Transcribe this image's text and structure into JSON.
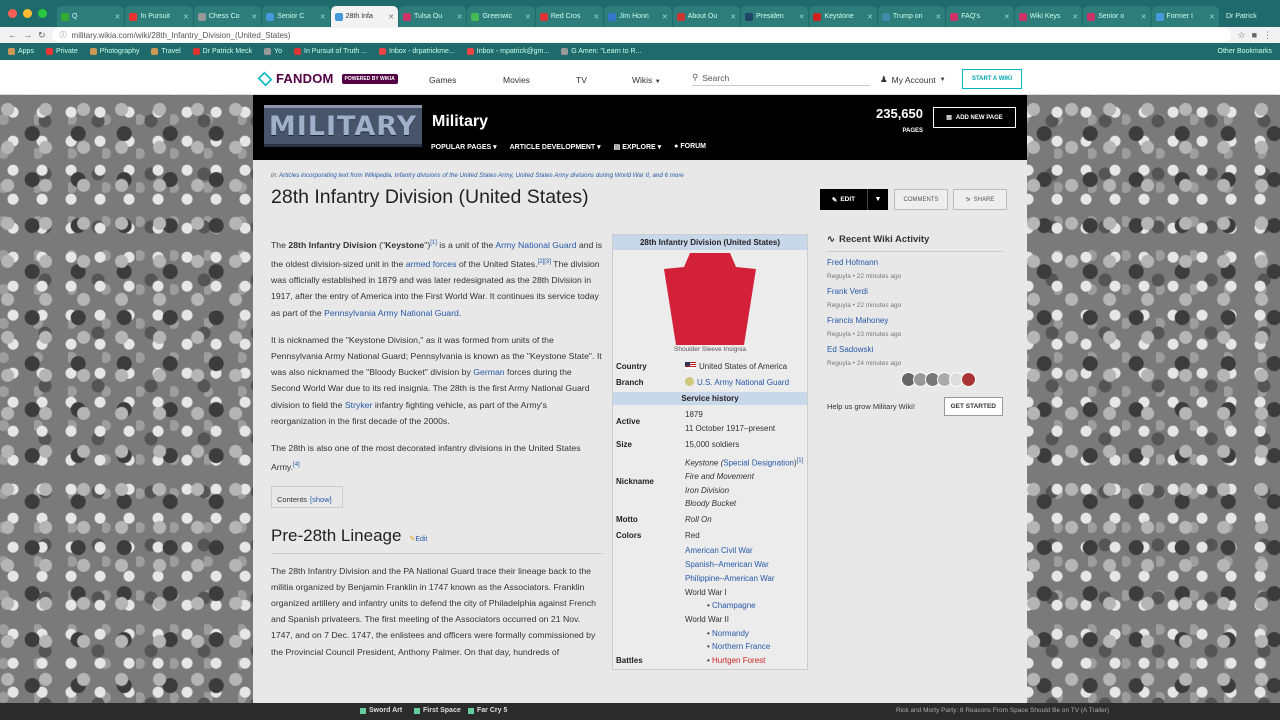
{
  "browser": {
    "tabs": [
      {
        "label": "Q",
        "color": "#3a3"
      },
      {
        "label": "In Pursuit",
        "color": "#e33"
      },
      {
        "label": "Chess Co",
        "color": "#999"
      },
      {
        "label": "Senior C",
        "color": "#49d"
      },
      {
        "label": "28th Infa",
        "color": "#49d",
        "active": true
      },
      {
        "label": "Tulsa Ou",
        "color": "#c36"
      },
      {
        "label": "Greenwic",
        "color": "#4b5"
      },
      {
        "label": "Red Cros",
        "color": "#d33"
      },
      {
        "label": "Jim Honn",
        "color": "#37c"
      },
      {
        "label": "About Ou",
        "color": "#c33"
      },
      {
        "label": "Presiden",
        "color": "#246"
      },
      {
        "label": "Keystone",
        "color": "#c22"
      },
      {
        "label": "Trump on",
        "color": "#48a"
      },
      {
        "label": "FAQ's",
        "color": "#c36"
      },
      {
        "label": "Wiki Keys",
        "color": "#c36"
      },
      {
        "label": "Senior o",
        "color": "#c36"
      },
      {
        "label": "Former I",
        "color": "#49d"
      }
    ],
    "profile": "Dr Patrick",
    "url": "military.wikia.com/wiki/28th_Infantry_Division_(United_States)",
    "bookmarks": [
      {
        "label": "Apps",
        "color": "#c95"
      },
      {
        "label": "Private",
        "color": "#e33"
      },
      {
        "label": "Photography",
        "color": "#c95"
      },
      {
        "label": "Travel",
        "color": "#c95"
      },
      {
        "label": "Dr Patrick Meck",
        "color": "#d33"
      },
      {
        "label": "Yo",
        "color": "#999"
      },
      {
        "label": "In Pursuit of Truth ...",
        "color": "#d33"
      },
      {
        "label": "Inbox - drpatrickme...",
        "color": "#e44"
      },
      {
        "label": "Inbox - mpatrick@gm...",
        "color": "#e44"
      },
      {
        "label": "G Amen: \"Learn to R...",
        "color": "#999"
      }
    ],
    "other_bookmarks": "Other Bookmarks"
  },
  "fandom": {
    "logo": "FANDOM",
    "powered": "POWERED BY WIKIA",
    "nav": [
      "Games",
      "Movies",
      "TV",
      "Wikis"
    ],
    "search_placeholder": "Search",
    "account": "My Account",
    "start_wiki": "START A WIKI"
  },
  "wiki": {
    "logo_text": "MILITARY",
    "name": "Military",
    "nav": [
      "POPULAR PAGES",
      "ARTICLE DEVELOPMENT",
      "EXPLORE",
      "FORUM"
    ],
    "page_count": "235,650",
    "page_count_label": "PAGES",
    "add_page": "ADD NEW PAGE"
  },
  "article": {
    "crumb_prefix": "in:",
    "crumb": "Articles incorporating text from Wikipedia, Infantry divisions of the United States Army, United States Army divisions during World War II, and 6 more",
    "title": "28th Infantry Division (United States)",
    "edit": "EDIT",
    "comments": "COMMENTS",
    "share": "SHARE",
    "p1": {
      "a": "The ",
      "b": "28th Infantry Division",
      "c": " (\"",
      "d": "Keystone",
      "e": "\")",
      "f": "[1]",
      "g": " is a unit of the ",
      "h": "Army National Guard",
      "i": " and is the oldest division-sized unit in the ",
      "j": "armed forces",
      "k": " of the United States.",
      "l": "[2][3]",
      "m": " The division was officially established in 1879 and was later redesignated as the 28th Division in 1917, after the entry of America into the First World War. It continues its service today as part of the ",
      "n": "Pennsylvania Army National Guard",
      "o": "."
    },
    "p2": {
      "a": "It is nicknamed the \"Keystone Division,\" as it was formed from units of the Pennsylvania Army National Guard; Pennsylvania is known as the \"Keystone State\". It was also nicknamed the \"Bloody Bucket\" division by ",
      "b": "German",
      "c": " forces during the Second World War due to its red insignia. The 28th is the first Army National Guard division to field the ",
      "d": "Stryker",
      "e": " infantry fighting vehicle, as part of the Army's reorganization in the first decade of the 2000s."
    },
    "p3": {
      "a": "The 28th is also one of the most decorated infantry divisions in the United States Army.",
      "b": "[4]"
    },
    "contents": "Contents",
    "show": "[show]",
    "h2": "Pre-28th Lineage",
    "h2_edit": "Edit",
    "p4": "The 28th Infantry Division and the PA National Guard trace their lineage back to the militia organized by Benjamin Franklin in 1747 known as the Associators. Franklin organized artillery and infantry units to defend the city of Philadelphia against French and Spanish privateers. The first meeting of the Associators occurred on 21 Nov. 1747, and on 7 Dec. 1747, the enlistees and officers were formally commissioned by the Provincial Council President, Anthony Palmer. On that day, hundreds of"
  },
  "infobox": {
    "title": "28th Infantry Division (United States)",
    "insignia_color": "#d3213a",
    "caption": "Shoulder Sleeve Insignia",
    "country_k": "Country",
    "country_v": "United States of America",
    "branch_k": "Branch",
    "branch_v": "U.S. Army National Guard",
    "service": "Service history",
    "active_k": "Active",
    "active_1": "1879",
    "active_2": "11 October 1917–present",
    "size_k": "Size",
    "size_v": "15,000 soldiers",
    "nick_k": "Nickname",
    "nick_1a": "Keystone (",
    "nick_1b": "Special Designation",
    "nick_1c": ")",
    "nick_1d": "[1]",
    "nick_2": "Fire and Movement",
    "nick_3": "Iron Division",
    "nick_4": "Bloody Bucket",
    "motto_k": "Motto",
    "motto_v": "Roll On",
    "colors_k": "Colors",
    "colors_v": "Red",
    "battles_k": "Battles",
    "b1": "American Civil War",
    "b2": "Spanish–American War",
    "b3": "Philippine–American War",
    "b4": "World War I",
    "b5": "Champagne",
    "b6": "World War II",
    "b7": "Normandy",
    "b8": "Northern France",
    "b9": "Hurtgen Forest"
  },
  "rail": {
    "title": "Recent Wiki Activity",
    "items": [
      {
        "name": "Fred Hofmann",
        "meta": "Reguyla • 22 minutes ago"
      },
      {
        "name": "Frank Verdi",
        "meta": "Reguyla • 22 minutes ago"
      },
      {
        "name": "Francis Mahoney",
        "meta": "Reguyla • 23 minutes ago"
      },
      {
        "name": "Ed Sadowski",
        "meta": "Reguyla • 24 minutes ago"
      }
    ],
    "help": "Help us grow Military Wiki!",
    "get_started": "GET STARTED"
  },
  "dock": {
    "items": [
      "Sword Art",
      "First Space",
      "Far Cry 5"
    ],
    "marquee": "Rick and Morty Party: 8 Reasons From Space Should Be on TV (A Trailer)"
  }
}
